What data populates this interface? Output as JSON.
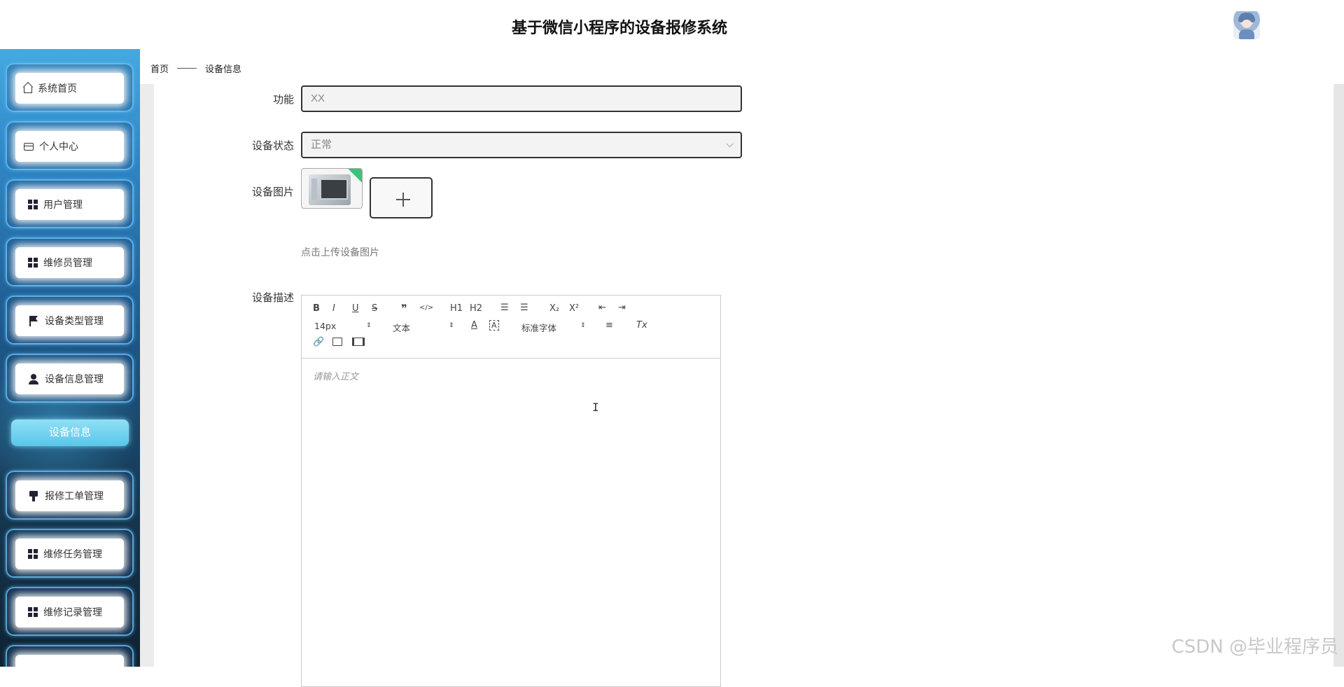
{
  "app": {
    "title": "基于微信小程序的设备报修系统"
  },
  "sidebar": {
    "items": [
      {
        "label": "系统首页",
        "icon": "home-icon"
      },
      {
        "label": "个人中心",
        "icon": "card-icon"
      },
      {
        "label": "用户管理",
        "icon": "grid-icon"
      },
      {
        "label": "维修员管理",
        "icon": "grid-icon"
      },
      {
        "label": "设备类型管理",
        "icon": "flag-icon"
      },
      {
        "label": "设备信息管理",
        "icon": "user-icon"
      },
      {
        "label": "报修工单管理",
        "icon": "brush-icon"
      },
      {
        "label": "维修任务管理",
        "icon": "grid-icon"
      },
      {
        "label": "维修记录管理",
        "icon": "grid-icon"
      }
    ],
    "active_sub": "设备信息"
  },
  "breadcrumb": {
    "home": "首页",
    "current": "设备信息"
  },
  "form": {
    "function": {
      "label": "功能",
      "value": "XX"
    },
    "status": {
      "label": "设备状态",
      "value": "正常"
    },
    "image": {
      "label": "设备图片",
      "hint": "点击上传设备图片"
    },
    "description": {
      "label": "设备描述",
      "placeholder": "请输入正文"
    }
  },
  "editor": {
    "font_size": "14px",
    "header_select": "文本",
    "font_family": "标准字体",
    "buttons": [
      "B",
      "I",
      "U",
      "S",
      "❞",
      "</>",
      "H1",
      "H2",
      "ordered-list",
      "bullet-list",
      "X₂",
      "X²",
      "outdent",
      "indent",
      "A",
      "background",
      "align",
      "Tx",
      "link",
      "image",
      "video"
    ]
  },
  "watermark": "CSDN @毕业程序员"
}
